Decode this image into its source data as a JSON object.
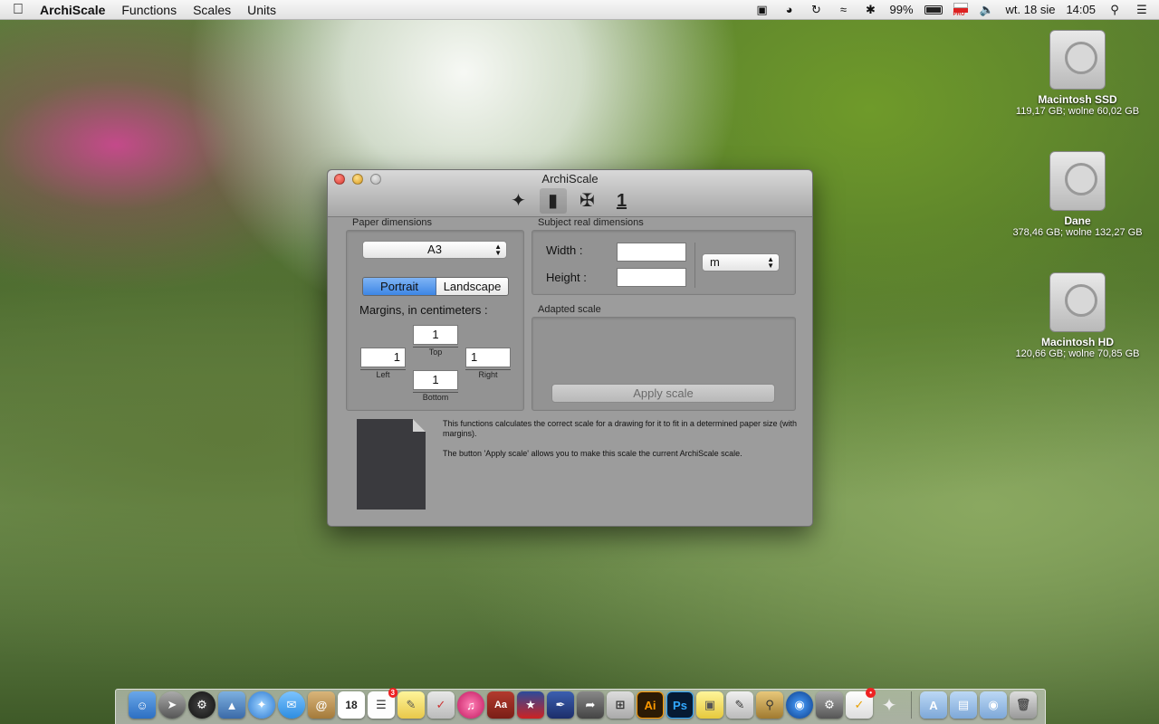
{
  "menubar": {
    "app_name": "ArchiScale",
    "menus": [
      "Functions",
      "Scales",
      "Units"
    ],
    "battery_percent": "99%",
    "datetime": "wt. 18 sie",
    "time": "14:05",
    "pro_flag": "PRO"
  },
  "drives": [
    {
      "name": "Macintosh SSD",
      "info": "119,17 GB; wolne 60,02 GB"
    },
    {
      "name": "Dane",
      "info": "378,46 GB; wolne 132,27 GB"
    },
    {
      "name": "Macintosh HD",
      "info": "120,66 GB; wolne 70,85 GB"
    }
  ],
  "window": {
    "title": "ArchiScale",
    "paper_dimensions_label": "Paper dimensions",
    "paper_size": "A3",
    "orientation": {
      "portrait": "Portrait",
      "landscape": "Landscape",
      "selected": "Portrait"
    },
    "margins_heading": "Margins, in centimeters :",
    "margins": {
      "top": {
        "label": "Top",
        "value": "1"
      },
      "left": {
        "label": "Left",
        "value": "1"
      },
      "right": {
        "label": "Right",
        "value": "1"
      },
      "bottom": {
        "label": "Bottom",
        "value": "1"
      }
    },
    "subject_label": "Subject real dimensions",
    "width_label": "Width :",
    "height_label": "Height :",
    "width_value": "",
    "height_value": "",
    "unit": "m",
    "adapted_scale_label": "Adapted scale",
    "apply_button": "Apply scale",
    "description_1": "This functions calculates the correct scale for a drawing for it to fit in a determined paper size (with margins).",
    "description_2": "The button 'Apply scale' allows you to make this scale the current ArchiScale scale.",
    "toolbar_number": "1"
  },
  "dock": {
    "calendar_day": "18",
    "reminders_badge": "3",
    "illustrator": "Ai",
    "photoshop": "Ps"
  },
  "colors": {
    "accent": "#3d86e5",
    "window_bg": "#9c9c9c"
  }
}
